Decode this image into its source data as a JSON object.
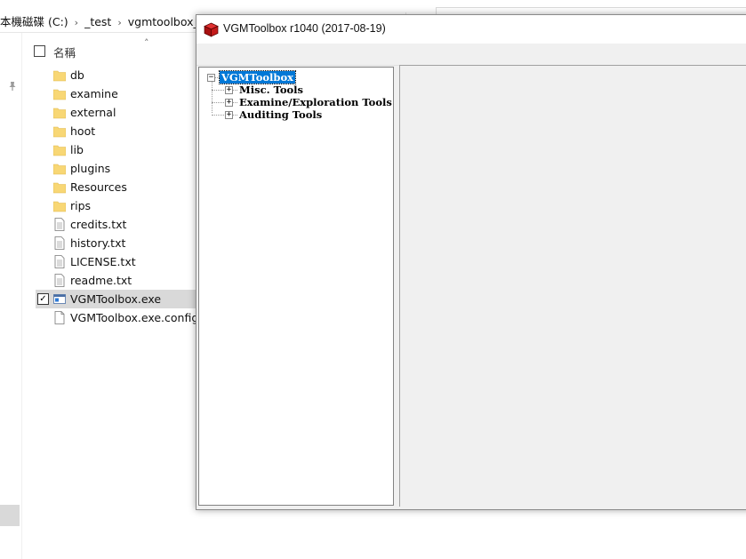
{
  "explorer": {
    "breadcrumb": [
      {
        "label": "本機磁碟 (C:)"
      },
      {
        "label": "_test"
      },
      {
        "label": "vgmtoolbox_b"
      }
    ],
    "column_header": {
      "name_label": "名稱",
      "sort_icon": "chevron-up-icon"
    },
    "files": [
      {
        "name": "db",
        "type": "folder"
      },
      {
        "name": "examine",
        "type": "folder"
      },
      {
        "name": "external",
        "type": "folder"
      },
      {
        "name": "hoot",
        "type": "folder"
      },
      {
        "name": "lib",
        "type": "folder"
      },
      {
        "name": "plugins",
        "type": "folder"
      },
      {
        "name": "Resources",
        "type": "folder"
      },
      {
        "name": "rips",
        "type": "folder"
      },
      {
        "name": "credits.txt",
        "type": "text"
      },
      {
        "name": "history.txt",
        "type": "text"
      },
      {
        "name": "LICENSE.txt",
        "type": "text"
      },
      {
        "name": "readme.txt",
        "type": "text"
      },
      {
        "name": "VGMToolbox.exe",
        "type": "exe",
        "selected": true
      },
      {
        "name": "VGMToolbox.exe.config",
        "type": "config"
      }
    ]
  },
  "app": {
    "title": "VGMToolbox r1040 (2017-08-19)",
    "icon": "red-cube-icon",
    "tree": {
      "root": "VGMToolbox",
      "children": [
        "Misc. Tools",
        "Examine/Exploration Tools",
        "Auditing Tools"
      ]
    }
  },
  "colors": {
    "selection": "#0078d7",
    "explorer_selected_row": "#d9d9d9",
    "folder": "#f8d775",
    "window_bg": "#f0f0f0"
  }
}
